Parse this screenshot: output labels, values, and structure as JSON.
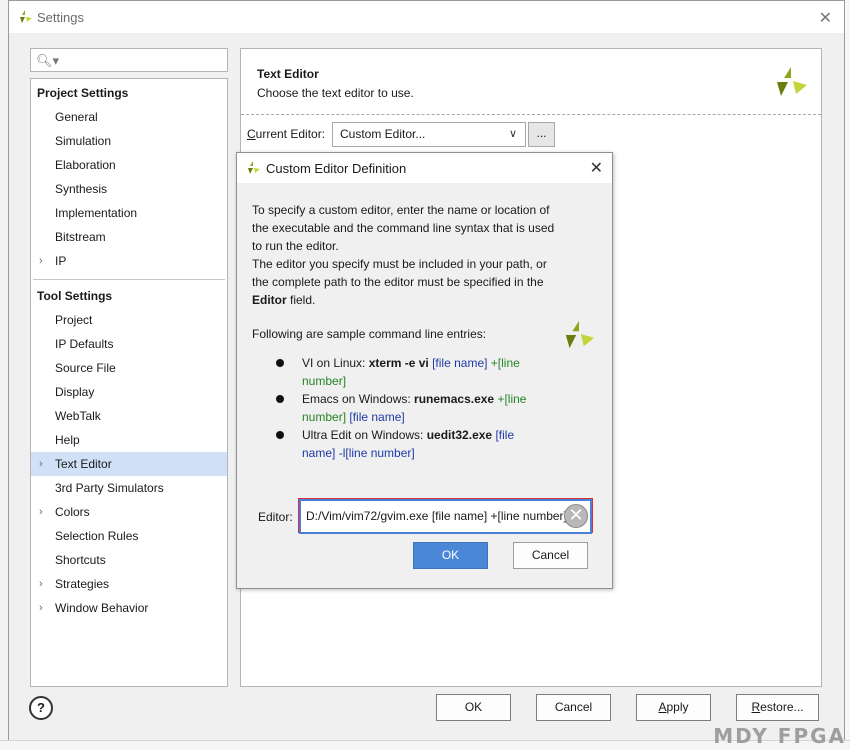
{
  "window": {
    "title": "Settings"
  },
  "search": {
    "placeholder": ""
  },
  "sidebar": {
    "project_settings": {
      "heading": "Project Settings",
      "items": [
        {
          "label": "General",
          "expandable": false
        },
        {
          "label": "Simulation",
          "expandable": false
        },
        {
          "label": "Elaboration",
          "expandable": false
        },
        {
          "label": "Synthesis",
          "expandable": false
        },
        {
          "label": "Implementation",
          "expandable": false
        },
        {
          "label": "Bitstream",
          "expandable": false
        },
        {
          "label": "IP",
          "expandable": true
        }
      ]
    },
    "tool_settings": {
      "heading": "Tool Settings",
      "items": [
        {
          "label": "Project",
          "expandable": false
        },
        {
          "label": "IP Defaults",
          "expandable": false
        },
        {
          "label": "Source File",
          "expandable": false
        },
        {
          "label": "Display",
          "expandable": false
        },
        {
          "label": "WebTalk",
          "expandable": false
        },
        {
          "label": "Help",
          "expandable": false
        },
        {
          "label": "Text Editor",
          "expandable": true,
          "selected": true
        },
        {
          "label": "3rd Party Simulators",
          "expandable": false
        },
        {
          "label": "Colors",
          "expandable": true
        },
        {
          "label": "Selection Rules",
          "expandable": false
        },
        {
          "label": "Shortcuts",
          "expandable": false
        },
        {
          "label": "Strategies",
          "expandable": true
        },
        {
          "label": "Window Behavior",
          "expandable": true
        }
      ]
    }
  },
  "content": {
    "title": "Text Editor",
    "subtitle": "Choose the text editor to use.",
    "current_editor_label": "Current Editor:",
    "current_editor_value": "Custom Editor...",
    "more_button": "..."
  },
  "dialog": {
    "title": "Custom Editor Definition",
    "para1": "To specify a custom editor, enter the name or location of the executable and the command line syntax that is used to run the editor.",
    "para2_prefix": "The editor you specify must be included in your path, or the complete path to the editor must be specified in the ",
    "para2_bold": "Editor",
    "para2_suffix": " field.",
    "sample_heading": "Following are sample command line entries:",
    "samples": [
      {
        "prefix": "VI on Linux: ",
        "cmd": "xterm -e vi",
        "file": "[file name]",
        "line": "+[line number]"
      },
      {
        "prefix": "Emacs on Windows: ",
        "cmd": "runemacs.exe",
        "line": "+[line number]",
        "file": "[file name]"
      },
      {
        "prefix": "Ultra Edit on Windows: ",
        "cmd": "uedit32.exe",
        "file": "[file name]",
        "line": "-l[line number]"
      }
    ],
    "editor_label": "Editor:",
    "editor_value": "D:/Vim/vim72/gvim.exe [file name] +[line number]",
    "ok_label": "OK",
    "cancel_label": "Cancel"
  },
  "footer": {
    "help_label": "?",
    "ok_label": "OK",
    "cancel_label": "Cancel",
    "apply_label": "Apply",
    "restore_label": "Restore..."
  },
  "watermark": "MDY FPGA",
  "colors": {
    "accent_blue": "#4a87d6",
    "highlight_red": "#d9303c",
    "selection": "#cfe0f7",
    "logo_green": "#8ea61a"
  }
}
